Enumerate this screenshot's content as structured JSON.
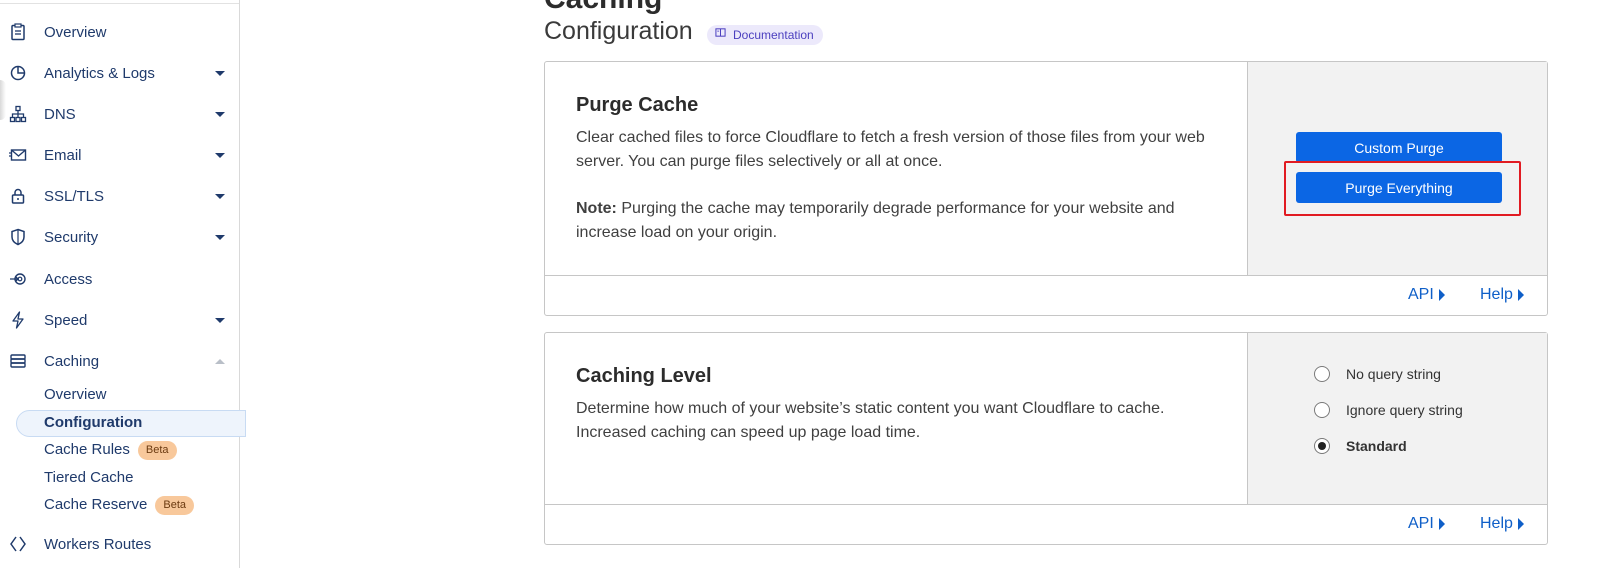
{
  "sidebar": {
    "items": [
      {
        "label": "Overview",
        "icon": "clipboard-icon"
      },
      {
        "label": "Analytics & Logs",
        "icon": "pie-chart-icon"
      },
      {
        "label": "DNS",
        "icon": "network-icon"
      },
      {
        "label": "Email",
        "icon": "envelope-icon"
      },
      {
        "label": "SSL/TLS",
        "icon": "lock-icon"
      },
      {
        "label": "Security",
        "icon": "shield-icon"
      },
      {
        "label": "Access",
        "icon": "access-icon"
      },
      {
        "label": "Speed",
        "icon": "lightning-icon"
      },
      {
        "label": "Caching",
        "icon": "stack-icon"
      }
    ],
    "caching_sub": [
      {
        "label": "Overview"
      },
      {
        "label": "Configuration"
      },
      {
        "label": "Cache Rules",
        "badge": "Beta"
      },
      {
        "label": "Tiered Cache"
      },
      {
        "label": "Cache Reserve",
        "badge": "Beta"
      }
    ],
    "workers_label": "Workers Routes"
  },
  "header": {
    "title": "Caching",
    "subtitle": "Configuration",
    "doc_chip": "Documentation"
  },
  "purge": {
    "title": "Purge Cache",
    "description": "Clear cached files to force Cloudflare to fetch a fresh version of those files from your web server. You can purge files selectively or all at once.",
    "note_label": "Note:",
    "note_text": " Purging the cache may temporarily degrade performance for your website and increase load on your origin.",
    "custom_purge": "Custom Purge",
    "purge_everything": "Purge Everything",
    "api": "API",
    "help": "Help"
  },
  "caching_level": {
    "title": "Caching Level",
    "description": "Determine how much of your website’s static content you want Cloudflare to cache. Increased caching can speed up page load time.",
    "options": [
      "No query string",
      "Ignore query string",
      "Standard"
    ],
    "selected": "Standard",
    "api": "API",
    "help": "Help"
  },
  "colors": {
    "accent": "#0b66e4",
    "highlight": "#e11b22",
    "badge": "#f8c89b",
    "link": "#0f5fc8"
  }
}
